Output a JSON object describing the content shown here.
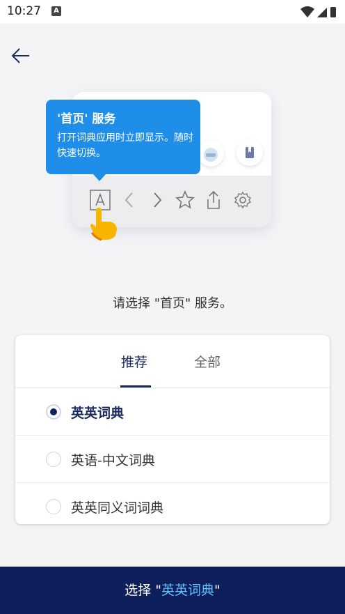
{
  "status": {
    "time": "10:27"
  },
  "tooltip": {
    "title": "'首页' 服务",
    "body": "打开词典应用时立即显示。随时快速切换。"
  },
  "prompt": "请选择 \"首页\" 服务。",
  "tabs": [
    {
      "label": "推荐",
      "active": true
    },
    {
      "label": "全部",
      "active": false
    }
  ],
  "options": [
    {
      "label": "英英词典",
      "selected": true
    },
    {
      "label": "英语-中文词典",
      "selected": false
    },
    {
      "label": "英英同义词词典",
      "selected": false
    }
  ],
  "bottom_button": {
    "prefix": "选择 \"",
    "selection": "英英词典",
    "suffix": "\""
  },
  "colors": {
    "accent": "#0f1f5c",
    "tooltip": "#1f8ee8",
    "highlight": "#5fc4ff"
  }
}
